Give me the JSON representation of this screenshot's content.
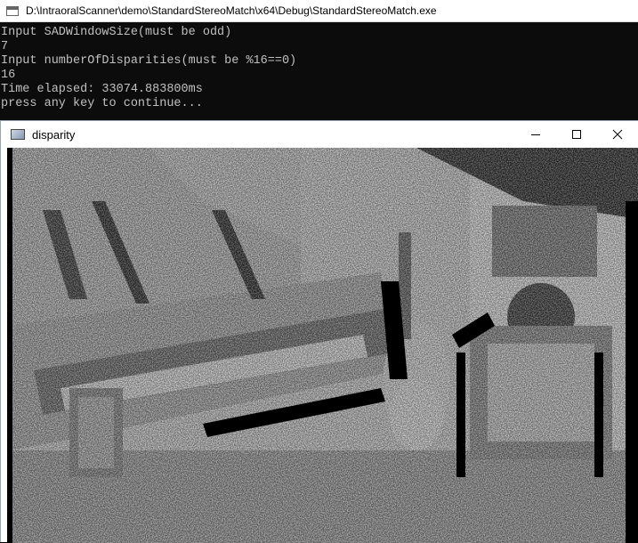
{
  "console": {
    "title": "D:\\IntraoralScanner\\demo\\StandardStereoMatch\\x64\\Debug\\StandardStereoMatch.exe",
    "lines": [
      "Input SADWindowSize(must be odd)",
      "7",
      "Input numberOfDisparities(must be %16==0)",
      "16",
      "Time elapsed: 33074.883800ms",
      "press any key to continue..."
    ]
  },
  "disparity_window": {
    "title": "disparity",
    "controls": {
      "minimize_icon": "minimize-icon",
      "maximize_icon": "maximize-icon",
      "close_icon": "close-icon"
    }
  },
  "colors": {
    "console_bg": "#0c0c0c",
    "console_text": "#c0c0c0",
    "titlebar_bg": "#ffffff"
  }
}
